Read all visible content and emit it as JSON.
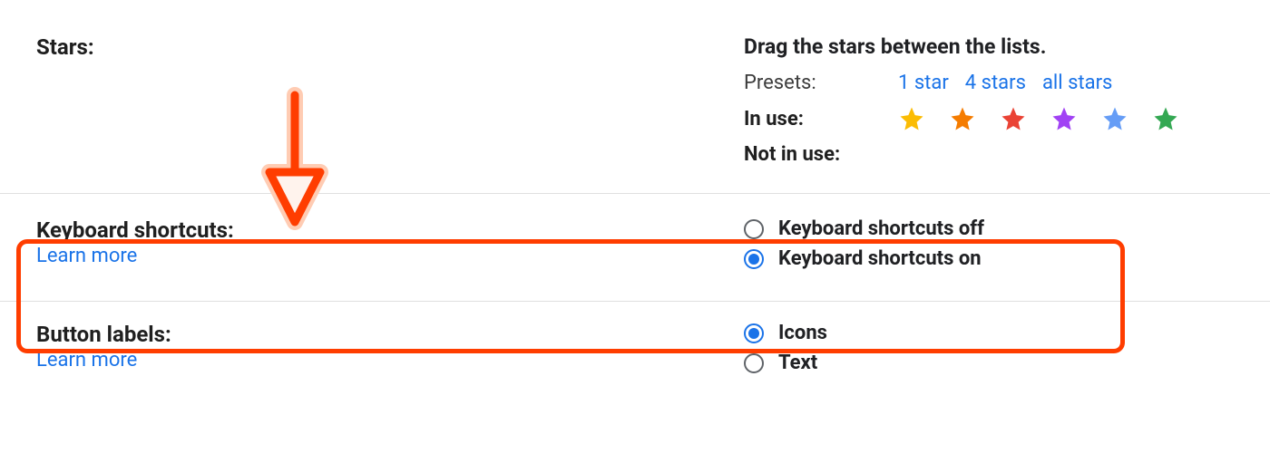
{
  "stars": {
    "label": "Stars:",
    "description": "Drag the stars between the lists.",
    "presets_label": "Presets:",
    "presets": [
      "1 star",
      "4 stars",
      "all stars"
    ],
    "in_use_label": "In use:",
    "not_in_use_label": "Not in use:",
    "star_colors": [
      "#fbbc04",
      "#f57c00",
      "#ea4335",
      "#a142f4",
      "#669df6",
      "#34a853"
    ]
  },
  "keyboard": {
    "label": "Keyboard shortcuts:",
    "learn_more": "Learn more",
    "options": [
      {
        "label": "Keyboard shortcuts off",
        "selected": false
      },
      {
        "label": "Keyboard shortcuts on",
        "selected": true
      }
    ]
  },
  "button_labels": {
    "label": "Button labels:",
    "learn_more": "Learn more",
    "options": [
      {
        "label": "Icons",
        "selected": true
      },
      {
        "label": "Text",
        "selected": false
      }
    ]
  }
}
